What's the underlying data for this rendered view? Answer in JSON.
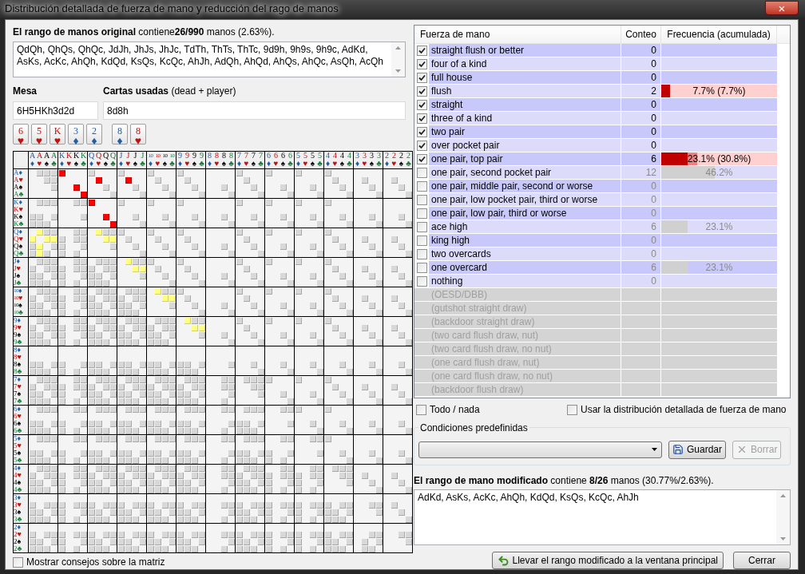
{
  "window": {
    "title": "Distribución detallada de fuerza de mano y reducción del rago de manos",
    "close": "×"
  },
  "original_range": {
    "label": "**El rango de manos original** contiene**26/990** manos (2.63%).",
    "text": "QdQh, QhQs, QhQc, JdJh, JhJs, JhJc, TdTh, ThTs, ThTc, 9d9h, 9h9s, 9h9c, AdKd, AsKs, AcKc, AhQh, KdQd, KsQs, KcQc, AhJh, AdQh, AhQd, AhQs, AhQc, AsQh, AcQh"
  },
  "board": {
    "label": "Mesa",
    "value": "6H5HKh3d2d"
  },
  "used": {
    "label": "**Cartas usadas** (dead + player)",
    "value": "8d8h"
  },
  "board_cards": [
    {
      "rank": "6",
      "suit": "♥",
      "color": "#c01010"
    },
    {
      "rank": "5",
      "suit": "♥",
      "color": "#c01010"
    },
    {
      "rank": "K",
      "suit": "♥",
      "color": "#c01010"
    },
    {
      "rank": "3",
      "suit": "♦",
      "color": "#1f5fa8"
    },
    {
      "rank": "2",
      "suit": "♦",
      "color": "#1f5fa8"
    }
  ],
  "used_cards": [
    {
      "rank": "8",
      "suit": "♦",
      "color": "#1f5fa8"
    },
    {
      "rank": "8",
      "suit": "♥",
      "color": "#c01010"
    }
  ],
  "matrix": {
    "columns": [
      {
        "rank": "A",
        "suit": "♦",
        "color": "#1f5fa8"
      },
      {
        "rank": "A",
        "suit": "♥",
        "color": "#c01010"
      },
      {
        "rank": "A",
        "suit": "♠",
        "color": "#000000"
      },
      {
        "rank": "A",
        "suit": "♣",
        "color": "#1a7a3a"
      },
      {
        "rank": "K",
        "suit": "♦",
        "color": "#1f5fa8"
      },
      {
        "rank": "K",
        "suit": "♥",
        "color": "#c01010"
      },
      {
        "rank": "K",
        "suit": "♠",
        "color": "#000000"
      },
      {
        "rank": "K",
        "suit": "♣",
        "color": "#1a7a3a"
      },
      {
        "rank": "Q",
        "suit": "♦",
        "color": "#1f5fa8"
      },
      {
        "rank": "Q",
        "suit": "♥",
        "color": "#c01010"
      },
      {
        "rank": "Q",
        "suit": "♠",
        "color": "#000000"
      },
      {
        "rank": "Q",
        "suit": "♣",
        "color": "#1a7a3a"
      },
      {
        "rank": "J",
        "suit": "♦",
        "color": "#1f5fa8"
      },
      {
        "rank": "J",
        "suit": "♥",
        "color": "#c01010"
      },
      {
        "rank": "J",
        "suit": "♠",
        "color": "#000000"
      },
      {
        "rank": "J",
        "suit": "♣",
        "color": "#1a7a3a"
      },
      {
        "rank": "10",
        "suit": "♦",
        "color": "#1f5fa8"
      },
      {
        "rank": "10",
        "suit": "♥",
        "color": "#c01010"
      },
      {
        "rank": "10",
        "suit": "♠",
        "color": "#000000"
      },
      {
        "rank": "10",
        "suit": "♣",
        "color": "#1a7a3a"
      },
      {
        "rank": "9",
        "suit": "♦",
        "color": "#1f5fa8"
      },
      {
        "rank": "9",
        "suit": "♥",
        "color": "#c01010"
      },
      {
        "rank": "9",
        "suit": "♠",
        "color": "#000000"
      },
      {
        "rank": "9",
        "suit": "♣",
        "color": "#1a7a3a"
      },
      {
        "rank": "8",
        "suit": "♦",
        "color": "#1f5fa8"
      },
      {
        "rank": "8",
        "suit": "♥",
        "color": "#c01010"
      },
      {
        "rank": "8",
        "suit": "♠",
        "color": "#000000"
      },
      {
        "rank": "8",
        "suit": "♣",
        "color": "#1a7a3a"
      },
      {
        "rank": "7",
        "suit": "♦",
        "color": "#1f5fa8"
      },
      {
        "rank": "7",
        "suit": "♥",
        "color": "#c01010"
      },
      {
        "rank": "7",
        "suit": "♠",
        "color": "#000000"
      },
      {
        "rank": "7",
        "suit": "♣",
        "color": "#1a7a3a"
      },
      {
        "rank": "6",
        "suit": "♦",
        "color": "#1f5fa8"
      },
      {
        "rank": "6",
        "suit": "♥",
        "color": "#c01010"
      },
      {
        "rank": "6",
        "suit": "♠",
        "color": "#000000"
      },
      {
        "rank": "6",
        "suit": "♣",
        "color": "#1a7a3a"
      },
      {
        "rank": "5",
        "suit": "♦",
        "color": "#1f5fa8"
      },
      {
        "rank": "5",
        "suit": "♥",
        "color": "#c01010"
      },
      {
        "rank": "5",
        "suit": "♠",
        "color": "#000000"
      },
      {
        "rank": "5",
        "suit": "♣",
        "color": "#1a7a3a"
      },
      {
        "rank": "4",
        "suit": "♦",
        "color": "#1f5fa8"
      },
      {
        "rank": "4",
        "suit": "♥",
        "color": "#c01010"
      },
      {
        "rank": "4",
        "suit": "♠",
        "color": "#000000"
      },
      {
        "rank": "4",
        "suit": "♣",
        "color": "#1a7a3a"
      },
      {
        "rank": "3",
        "suit": "♦",
        "color": "#1f5fa8"
      },
      {
        "rank": "3",
        "suit": "♥",
        "color": "#c01010"
      },
      {
        "rank": "3",
        "suit": "♠",
        "color": "#000000"
      },
      {
        "rank": "3",
        "suit": "♣",
        "color": "#1a7a3a"
      },
      {
        "rank": "2",
        "suit": "♦",
        "color": "#1f5fa8"
      },
      {
        "rank": "2",
        "suit": "♥",
        "color": "#c01010"
      },
      {
        "rank": "2",
        "suit": "♠",
        "color": "#000000"
      },
      {
        "rank": "2",
        "suit": "♣",
        "color": "#1a7a3a"
      }
    ],
    "rows": [
      {
        "rank": "A",
        "suit": "♦",
        "color": "#1f5fa8",
        "dead": false,
        "blocks": [
          {
            "kind": "plain"
          },
          {
            "kind": "marked",
            "cells": [
              {
                "kind": "kept"
              },
              {
                "kind": "plain"
              },
              {
                "kind": "plain"
              },
              {
                "kind": "plain"
              }
            ]
          }
        ]
      },
      {
        "rank": "A",
        "suit": "♥",
        "color": "#c01010",
        "dead": false,
        "blocks": [
          {
            "kind": "plain"
          },
          {
            "kind": "plain"
          },
          {
            "kind": "marked",
            "cells": [
              {
                "kind": "plain"
              },
              {
                "kind": "kept"
              },
              {
                "kind": "plain"
              },
              {
                "kind": "plain"
              }
            ]
          },
          {
            "kind": "marked",
            "cells": [
              {
                "kind": "plain"
              },
              {
                "kind": "kept"
              },
              {
                "kind": "plain"
              },
              {
                "kind": "plain"
              }
            ]
          }
        ]
      },
      {
        "rank": "A",
        "suit": "♠",
        "color": "#000000",
        "dead": false,
        "blocks": [
          {
            "kind": "plain"
          },
          {
            "kind": "marked",
            "cells": [
              {
                "kind": "plain"
              },
              {
                "kind": "plain"
              },
              {
                "kind": "kept"
              },
              {
                "kind": "plain"
              }
            ]
          }
        ]
      },
      {
        "rank": "A",
        "suit": "♣",
        "color": "#1a7a3a",
        "dead": false,
        "blocks": [
          {
            "kind": "plain"
          },
          {
            "kind": "marked",
            "cells": [
              {
                "kind": "plain"
              },
              {
                "kind": "plain"
              },
              {
                "kind": "plain"
              },
              {
                "kind": "kept"
              }
            ]
          }
        ]
      },
      {
        "rank": "K",
        "suit": "♦",
        "color": "#1f5fa8",
        "dead": false,
        "blocks": [
          {
            "kind": "plain"
          },
          {
            "kind": "plain"
          },
          {
            "kind": "marked",
            "cells": [
              {
                "kind": "kept"
              },
              {
                "kind": "plain"
              },
              {
                "kind": "plain"
              },
              {
                "kind": "plain"
              }
            ]
          }
        ]
      },
      {
        "rank": "K",
        "suit": "♥",
        "color": "#c01010",
        "dead": true
      },
      {
        "rank": "K",
        "suit": "♠",
        "color": "#000000",
        "dead": false,
        "blocks": [
          {
            "kind": "plain"
          },
          {
            "kind": "plain"
          },
          {
            "kind": "marked",
            "cells": [
              {
                "kind": "plain"
              },
              {
                "kind": "plain"
              },
              {
                "kind": "kept"
              },
              {
                "kind": "plain"
              }
            ]
          }
        ]
      },
      {
        "rank": "K",
        "suit": "♣",
        "color": "#1a7a3a",
        "dead": false,
        "blocks": [
          {
            "kind": "plain"
          },
          {
            "kind": "plain"
          },
          {
            "kind": "marked",
            "cells": [
              {
                "kind": "plain"
              },
              {
                "kind": "plain"
              },
              {
                "kind": "plain"
              },
              {
                "kind": "kept"
              }
            ]
          }
        ]
      },
      {
        "rank": "Q",
        "suit": "♦",
        "color": "#1f5fa8",
        "dead": false,
        "blocks": [
          {
            "kind": "marked",
            "cells": [
              {
                "kind": "plain"
              },
              {
                "kind": "original"
              },
              {
                "kind": "plain"
              },
              {
                "kind": "plain"
              }
            ]
          },
          {
            "kind": "plain"
          },
          {
            "kind": "marked",
            "cells": [
              {
                "kind": "plain"
              },
              {
                "kind": "original"
              },
              {
                "kind": "plain"
              },
              {
                "kind": "plain"
              }
            ]
          }
        ]
      },
      {
        "rank": "Q",
        "suit": "♥",
        "color": "#c01010",
        "dead": false,
        "blocks": [
          {
            "kind": "marked",
            "cells": [
              {
                "kind": "original"
              },
              {
                "kind": "plain"
              },
              {
                "kind": "original"
              },
              {
                "kind": "original"
              }
            ]
          },
          {
            "kind": "plain"
          },
          {
            "kind": "marked",
            "cells": [
              {
                "kind": "plain"
              },
              {
                "kind": "plain"
              },
              {
                "kind": "original"
              },
              {
                "kind": "original"
              }
            ]
          }
        ]
      },
      {
        "rank": "Q",
        "suit": "♠",
        "color": "#000000",
        "dead": false,
        "blocks": [
          {
            "kind": "marked",
            "cells": [
              {
                "kind": "plain"
              },
              {
                "kind": "original"
              },
              {
                "kind": "plain"
              },
              {
                "kind": "plain"
              }
            ]
          }
        ]
      },
      {
        "rank": "Q",
        "suit": "♣",
        "color": "#1a7a3a",
        "dead": false,
        "blocks": [
          {
            "kind": "marked",
            "cells": [
              {
                "kind": "plain"
              },
              {
                "kind": "original"
              },
              {
                "kind": "plain"
              },
              {
                "kind": "plain"
              }
            ]
          }
        ]
      },
      {
        "rank": "J",
        "suit": "♦",
        "color": "#1f5fa8",
        "dead": false,
        "blocks": [
          {
            "kind": "plain"
          },
          {
            "kind": "plain"
          },
          {
            "kind": "plain"
          },
          {
            "kind": "marked",
            "cells": [
              {
                "kind": "plain"
              },
              {
                "kind": "original"
              },
              {
                "kind": "plain"
              },
              {
                "kind": "plain"
              }
            ]
          }
        ]
      },
      {
        "rank": "J",
        "suit": "♥",
        "color": "#c01010",
        "dead": false,
        "blocks": [
          {
            "kind": "plain"
          },
          {
            "kind": "plain"
          },
          {
            "kind": "plain"
          },
          {
            "kind": "marked",
            "cells": [
              {
                "kind": "plain"
              },
              {
                "kind": "plain"
              },
              {
                "kind": "original"
              },
              {
                "kind": "original"
              }
            ]
          }
        ]
      },
      {
        "rank": "J",
        "suit": "♠",
        "color": "#000000",
        "dead": false
      },
      {
        "rank": "J",
        "suit": "♣",
        "color": "#1a7a3a",
        "dead": false
      },
      {
        "rank": "10",
        "suit": "♦",
        "color": "#1f5fa8",
        "dead": false,
        "blocks": [
          {
            "kind": "plain"
          },
          {
            "kind": "plain"
          },
          {
            "kind": "plain"
          },
          {
            "kind": "plain"
          },
          {
            "kind": "marked",
            "cells": [
              {
                "kind": "plain"
              },
              {
                "kind": "original"
              },
              {
                "kind": "plain"
              },
              {
                "kind": "plain"
              }
            ]
          }
        ]
      },
      {
        "rank": "10",
        "suit": "♥",
        "color": "#c01010",
        "dead": false,
        "blocks": [
          {
            "kind": "plain"
          },
          {
            "kind": "plain"
          },
          {
            "kind": "plain"
          },
          {
            "kind": "plain"
          },
          {
            "kind": "marked",
            "cells": [
              {
                "kind": "plain"
              },
              {
                "kind": "plain"
              },
              {
                "kind": "original"
              },
              {
                "kind": "original"
              }
            ]
          }
        ]
      },
      {
        "rank": "10",
        "suit": "♠",
        "color": "#000000",
        "dead": false
      },
      {
        "rank": "10",
        "suit": "♣",
        "color": "#1a7a3a",
        "dead": false
      },
      {
        "rank": "9",
        "suit": "♦",
        "color": "#1f5fa8",
        "dead": false,
        "blocks": [
          {
            "kind": "plain"
          },
          {
            "kind": "plain"
          },
          {
            "kind": "plain"
          },
          {
            "kind": "plain"
          },
          {
            "kind": "plain"
          },
          {
            "kind": "marked",
            "cells": [
              {
                "kind": "plain"
              },
              {
                "kind": "original"
              },
              {
                "kind": "plain"
              },
              {
                "kind": "plain"
              }
            ]
          }
        ]
      },
      {
        "rank": "9",
        "suit": "♥",
        "color": "#c01010",
        "dead": false,
        "blocks": [
          {
            "kind": "plain"
          },
          {
            "kind": "plain"
          },
          {
            "kind": "plain"
          },
          {
            "kind": "plain"
          },
          {
            "kind": "plain"
          },
          {
            "kind": "marked",
            "cells": [
              {
                "kind": "plain"
              },
              {
                "kind": "plain"
              },
              {
                "kind": "original"
              },
              {
                "kind": "original"
              }
            ]
          }
        ]
      },
      {
        "rank": "9",
        "suit": "♠",
        "color": "#000000",
        "dead": false
      },
      {
        "rank": "9",
        "suit": "♣",
        "color": "#1a7a3a",
        "dead": false
      },
      {
        "rank": "8",
        "suit": "♦",
        "color": "#1f5fa8",
        "dead": true
      },
      {
        "rank": "8",
        "suit": "♥",
        "color": "#c01010",
        "dead": true
      },
      {
        "rank": "8",
        "suit": "♠",
        "color": "#000000",
        "dead": false
      },
      {
        "rank": "8",
        "suit": "♣",
        "color": "#1a7a3a",
        "dead": false
      },
      {
        "rank": "7",
        "suit": "♦",
        "color": "#1f5fa8",
        "dead": false
      },
      {
        "rank": "7",
        "suit": "♥",
        "color": "#c01010",
        "dead": false
      },
      {
        "rank": "7",
        "suit": "♠",
        "color": "#000000",
        "dead": false
      },
      {
        "rank": "7",
        "suit": "♣",
        "color": "#1a7a3a",
        "dead": false
      },
      {
        "rank": "6",
        "suit": "♦",
        "color": "#1f5fa8",
        "dead": false
      },
      {
        "rank": "6",
        "suit": "♥",
        "color": "#c01010",
        "dead": true
      },
      {
        "rank": "6",
        "suit": "♠",
        "color": "#000000",
        "dead": false
      },
      {
        "rank": "6",
        "suit": "♣",
        "color": "#1a7a3a",
        "dead": false
      },
      {
        "rank": "5",
        "suit": "♦",
        "color": "#1f5fa8",
        "dead": false
      },
      {
        "rank": "5",
        "suit": "♥",
        "color": "#c01010",
        "dead": true
      },
      {
        "rank": "5",
        "suit": "♠",
        "color": "#000000",
        "dead": false
      },
      {
        "rank": "5",
        "suit": "♣",
        "color": "#1a7a3a",
        "dead": false
      },
      {
        "rank": "4",
        "suit": "♦",
        "color": "#1f5fa8",
        "dead": false
      },
      {
        "rank": "4",
        "suit": "♥",
        "color": "#c01010",
        "dead": false
      },
      {
        "rank": "4",
        "suit": "♠",
        "color": "#000000",
        "dead": false
      },
      {
        "rank": "4",
        "suit": "♣",
        "color": "#1a7a3a",
        "dead": false
      },
      {
        "rank": "3",
        "suit": "♦",
        "color": "#1f5fa8",
        "dead": true
      },
      {
        "rank": "3",
        "suit": "♥",
        "color": "#c01010",
        "dead": false
      },
      {
        "rank": "3",
        "suit": "♠",
        "color": "#000000",
        "dead": false
      },
      {
        "rank": "3",
        "suit": "♣",
        "color": "#1a7a3a",
        "dead": false
      },
      {
        "rank": "2",
        "suit": "♦",
        "color": "#1f5fa8",
        "dead": true
      },
      {
        "rank": "2",
        "suit": "♥",
        "color": "#c01010",
        "dead": false
      },
      {
        "rank": "2",
        "suit": "♠",
        "color": "#000000",
        "dead": false
      },
      {
        "rank": "2",
        "suit": "♣",
        "color": "#1a7a3a",
        "dead": false
      }
    ]
  },
  "matrix_tips": {
    "label": "Mostrar consejos sobre la matriz",
    "checked": false
  },
  "strength_table": {
    "columns": [
      "Fuerza de mano",
      "Conteo",
      "Frecuencia (acumulada)"
    ],
    "rows": [
      {
        "kind": "hand",
        "label": "straight flush or better",
        "checked": true,
        "count": "0"
      },
      {
        "kind": "hand",
        "label": "four of a kind",
        "checked": true,
        "count": "0"
      },
      {
        "kind": "hand",
        "label": "full house",
        "checked": true,
        "count": "0"
      },
      {
        "kind": "hand",
        "label": "flush",
        "checked": true,
        "count": "2",
        "frequency": "7.7% (7.7%)",
        "bars": [
          {
            "kind": "own",
            "level": 0.077
          }
        ]
      },
      {
        "kind": "hand",
        "label": "straight",
        "checked": true,
        "count": "0"
      },
      {
        "kind": "hand",
        "label": "three of a kind",
        "checked": true,
        "count": "0"
      },
      {
        "kind": "hand",
        "label": "two pair",
        "checked": true,
        "count": "0"
      },
      {
        "kind": "hand",
        "label": "over pocket pair",
        "checked": true,
        "count": "0"
      },
      {
        "kind": "hand",
        "label": "one pair, top pair",
        "checked": true,
        "count": "6",
        "frequency": "23.1% (30.8%)",
        "bars": [
          {
            "kind": "cumulative",
            "level": 0.308
          },
          {
            "kind": "own",
            "level": 0.231
          }
        ]
      },
      {
        "kind": "hand",
        "label": "one pair, second pocket pair",
        "checked": false,
        "count": "12",
        "frequency": "46.2%",
        "bars": [
          {
            "kind": "own",
            "level": 0.462
          }
        ]
      },
      {
        "kind": "hand",
        "label": "one pair, middle pair, second or worse",
        "checked": false,
        "count": "0"
      },
      {
        "kind": "hand",
        "label": "one pair, low pocket pair, third or worse",
        "checked": false,
        "count": "0"
      },
      {
        "kind": "hand",
        "label": "one pair, low pair, third or worse",
        "checked": false,
        "count": "0"
      },
      {
        "kind": "hand",
        "label": "ace high",
        "checked": false,
        "count": "6",
        "frequency": "23.1%",
        "bars": [
          {
            "kind": "own",
            "level": 0.231
          }
        ]
      },
      {
        "kind": "hand",
        "label": "king high",
        "checked": false,
        "count": "0"
      },
      {
        "kind": "hand",
        "label": "two overcards",
        "checked": false,
        "count": "0"
      },
      {
        "kind": "hand",
        "label": "one overcard",
        "checked": false,
        "count": "6",
        "frequency": "23.1%",
        "bars": [
          {
            "kind": "own",
            "level": 0.231
          }
        ]
      },
      {
        "kind": "hand",
        "label": "nothing",
        "checked": false,
        "count": "0"
      },
      {
        "kind": "draw",
        "label": "(OESD/DBB)"
      },
      {
        "kind": "draw",
        "label": "(gutshot straight draw)"
      },
      {
        "kind": "draw",
        "label": "(backdoor straight draw)"
      },
      {
        "kind": "draw",
        "label": "(two card flush draw, nut)"
      },
      {
        "kind": "draw",
        "label": "(two card flush draw, no nut)"
      },
      {
        "kind": "draw",
        "label": "(one card flush draw, nut)"
      },
      {
        "kind": "draw",
        "label": "(one card flush draw, no nut)"
      },
      {
        "kind": "draw",
        "label": "(backdoor flush draw)"
      }
    ]
  },
  "all_none": {
    "label": "Todo / nada",
    "checked": false
  },
  "use_detailed": {
    "label": "Usar la distribución detallada de fuerza de mano",
    "checked": false
  },
  "predefined": {
    "title": "Condiciones predefinidas",
    "save": "Guardar",
    "delete": {
      "label": "Borrar",
      "disabled": true
    }
  },
  "modified_range": {
    "label": "**El rango de mano modificado** contiene **8/26** manos (30.77%/2.63%).",
    "text": "AdKd, AsKs, AcKc, AhQh, KdQd, KsQs, KcQc, AhJh"
  },
  "buttons": {
    "apply": "Llevar el rango modificado a la ventana principal",
    "close": "Cerrar"
  }
}
